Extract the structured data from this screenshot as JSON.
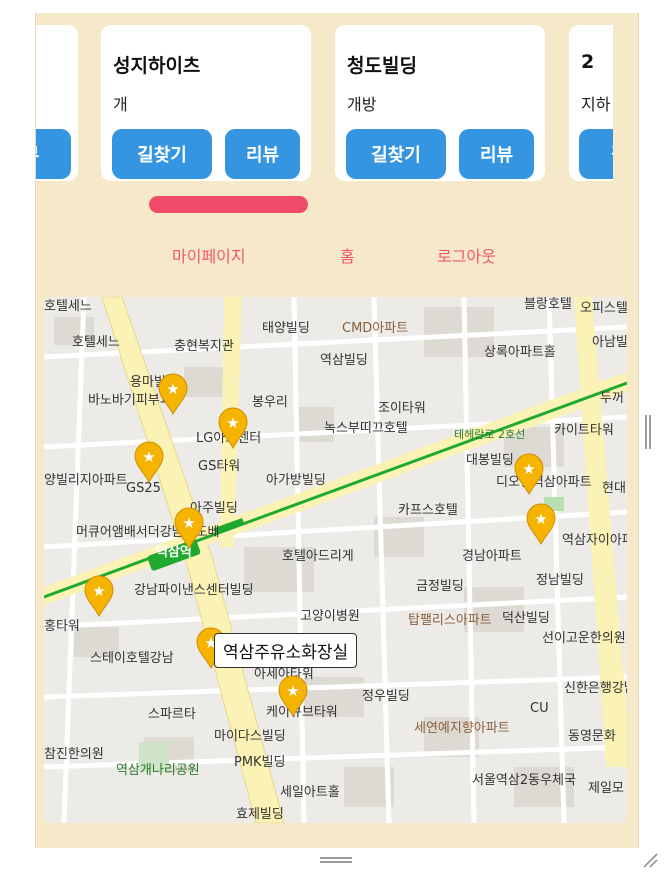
{
  "cards": [
    {
      "name": "",
      "desc": "",
      "route_label": "",
      "review_label": "뷰"
    },
    {
      "name": "성지하이츠",
      "desc": "개",
      "route_label": "길찾기",
      "review_label": "리뷰"
    },
    {
      "name": "청도빌딩",
      "desc": "개방",
      "route_label": "길찾기",
      "review_label": "리뷰"
    },
    {
      "name": "2",
      "desc": "지하",
      "route_label": "길",
      "review_label": ""
    }
  ],
  "nav": {
    "mypage": "마이페이지",
    "home": "홈",
    "logout": "로그아웃"
  },
  "map": {
    "tooltip": "역삼주유소화장실",
    "labels": [
      "호텔세느",
      "충현복지관",
      "태양빌딩",
      "CMD아파트",
      "블랑호텔",
      "오피스텔",
      "상록아파트홀",
      "아남빌딩",
      "역삼빌딩",
      "용마빌딩",
      "바노바기피부과",
      "봉우리",
      "조이타워",
      "녹스부띠끄호텔",
      "카이트타워",
      "두꺼",
      "LG아트센터",
      "GS타워",
      "아가방빌딩",
      "대봉빌딩",
      "디오빌역삼아파트",
      "현대",
      "테헤란로 2호선",
      "양빌리지아파트",
      "GS25",
      "아주빌딩",
      "카프스호텔",
      "머큐어앰배서더강남쏘도베",
      "역삼역",
      "호텔아드리게",
      "경남아파트",
      "역삼자이아파트",
      "강남파이낸스센터빌딩",
      "금정빌딩",
      "정남빌딩",
      "홍타워",
      "고양이병원",
      "탑팰리스아파트",
      "덕산빌딩",
      "선이고운한의원",
      "스테이호텔강남",
      "아세아타워",
      "정우빌딩",
      "신한은행강남별관",
      "스파르타",
      "케이큐브타워",
      "CU",
      "세연예지향아파트",
      "마이다스빌딩",
      "동영문화",
      "참진한의원",
      "역삼개나리공원",
      "PMK빌딩",
      "세일아트홀",
      "서울역삼2동우체국",
      "제일모",
      "효제빌딩"
    ]
  },
  "colors": {
    "background": "#f5e9c9",
    "button": "#3595e0",
    "accent": "#f24b6a",
    "nav_text": "#f2566e",
    "line2": "#1fa92e",
    "marker": "#f5b400"
  },
  "icons": [
    "star-marker-icon",
    "hotel-icon",
    "cafe-icon",
    "shop-icon",
    "park-icon",
    "bank-icon"
  ]
}
